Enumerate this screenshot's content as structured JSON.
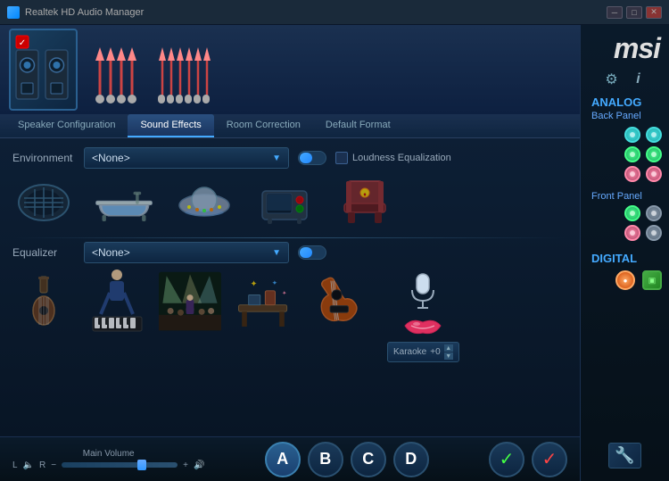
{
  "titlebar": {
    "title": "Realtek HD Audio Manager",
    "minimize": "─",
    "maximize": "□",
    "close": "✕"
  },
  "tabs": [
    {
      "id": "speaker-config",
      "label": "Speaker Configuration",
      "active": false
    },
    {
      "id": "sound-effects",
      "label": "Sound Effects",
      "active": true
    },
    {
      "id": "room-correction",
      "label": "Room Correction",
      "active": false
    },
    {
      "id": "default-format",
      "label": "Default Format",
      "active": false
    }
  ],
  "soundEffects": {
    "environmentLabel": "Environment",
    "environmentValue": "<None>",
    "loudnessLabel": "Loudness Equalization",
    "equalizerLabel": "Equalizer",
    "equalizerValue": "<None>",
    "karaokeLabel": "Karaoke",
    "karaokeValue": "+0"
  },
  "bottomBar": {
    "volumeLabel": "Main Volume",
    "lLabel": "L",
    "rLabel": "R",
    "minusLabel": "−",
    "plusLabel": "+",
    "speakerIcon": "🔊",
    "buttons": [
      {
        "id": "btn-a",
        "label": "A"
      },
      {
        "id": "btn-b",
        "label": "B"
      },
      {
        "id": "btn-c",
        "label": "C"
      },
      {
        "id": "btn-d",
        "label": "D"
      }
    ]
  },
  "sidebar": {
    "logoText": "msi",
    "analogLabel": "ANALOG",
    "backPanelLabel": "Back Panel",
    "frontPanelLabel": "Front Panel",
    "digitalLabel": "DIGITAL"
  }
}
